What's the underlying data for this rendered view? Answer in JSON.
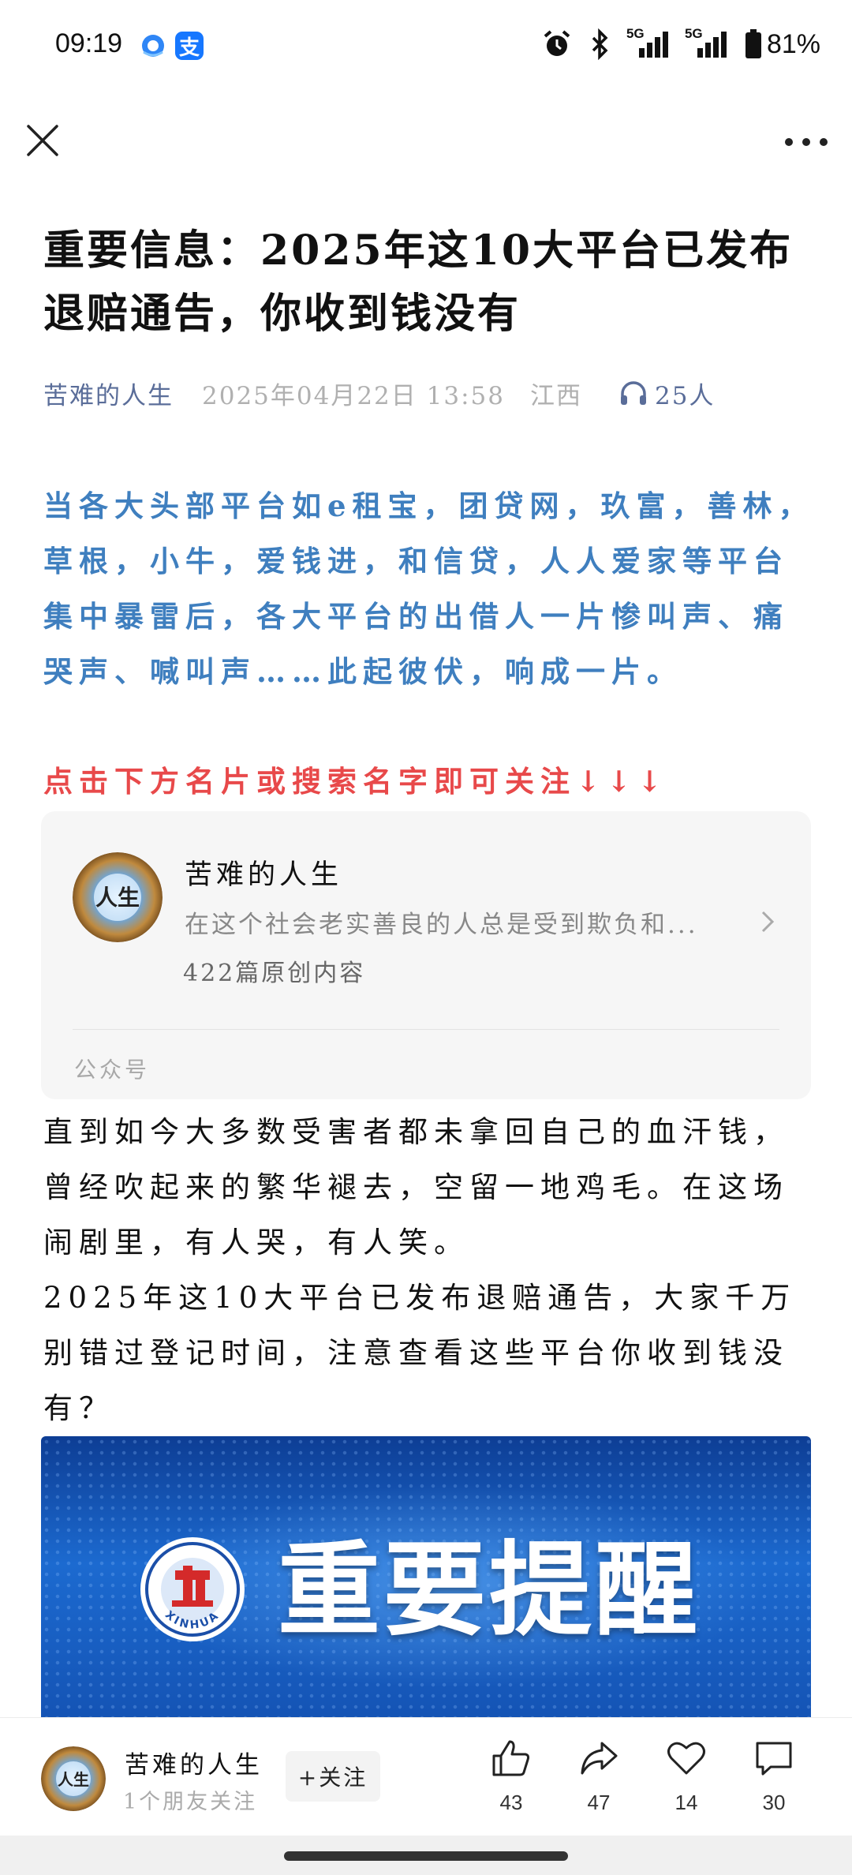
{
  "status_bar": {
    "time": "09:19",
    "battery": "81%",
    "network_1": "5G",
    "network_2": "5G",
    "icons": [
      "browser-icon",
      "alipay-icon",
      "alarm-icon",
      "bluetooth-icon",
      "signal-icon",
      "battery-icon"
    ],
    "alipay_glyph": "支"
  },
  "nav": {
    "close_icon": "close-icon",
    "more_icon": "more-icon"
  },
  "article": {
    "title": "重要信息：2025年这10大平台已发布退赔通告，你收到钱没有",
    "author": "苦难的人生",
    "date": "2025年04月22日 13:58",
    "location": "江西",
    "listeners": "25人",
    "intro": "当各大头部平台如e租宝，团贷网，玖富，善林，草根，小牛，爱钱进，和信贷，人人爱家等平台集中暴雷后，各大平台的出借人一片惨叫声、痛哭声、喊叫声……此起彼伏，响成一片。",
    "prompt": "点击下方名片或搜索名字即可关注↓↓↓",
    "body": "直到如今大多数受害者都未拿回自己的血汗钱，曾经吹起来的繁华褪去，空留一地鸡毛。在这场闹剧里，有人哭，有人笑。",
    "body2": "2025年这10大平台已发布退赔通告，大家千万别错过登记时间，注意查看这些平台你收到钱没有？"
  },
  "profile_card": {
    "name": "苦难的人生",
    "description": "在这个社会老实善良的人总是受到欺负和...",
    "count": "422篇原创内容",
    "footer": "公众号",
    "avatar_glyph": "人生"
  },
  "banner": {
    "text": "重要提醒",
    "logo_text": "XINHUA"
  },
  "bottom_bar": {
    "author": "苦难的人生",
    "subtitle": "1个朋友关注",
    "follow_label": "+关注",
    "like_count": "43",
    "share_count": "47",
    "favorite_count": "14",
    "comment_count": "30"
  },
  "colors": {
    "intro_blue": "#3f7fbf",
    "prompt_red": "#e8494a",
    "author_link": "#5a6d99"
  }
}
